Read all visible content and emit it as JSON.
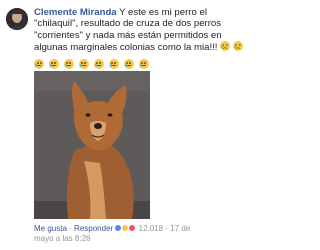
{
  "comment": {
    "author": "Clemente Miranda",
    "text": "Y este es mi perro el \"chilaquil\", resultado de cruza de dos perros \"corrientes\" y nada más están permitidos en algunas marginales colonias como la mia!!!"
  },
  "emoji_row": [
    "crying-face",
    "crying-face",
    "crying-face",
    "crying-face",
    "crying-face",
    "crying-face",
    "crying-face",
    "crying-face"
  ],
  "photo": {
    "subject": "brown dog sitting"
  },
  "footer": {
    "like_label": "Me gusta",
    "reply_label": "Responder",
    "reaction_count": "12.018",
    "sep": "·",
    "timestamp_line1": "17 de",
    "timestamp_line2": "mayo a las 8:26"
  },
  "colors": {
    "link": "#385898",
    "muted": "#90949c",
    "text": "#1d2129"
  }
}
